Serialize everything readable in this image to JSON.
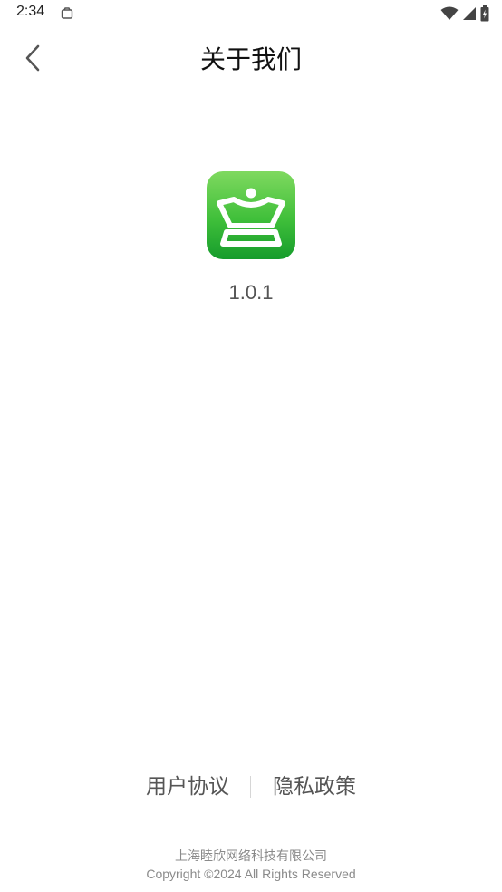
{
  "status_bar": {
    "time": "2:34",
    "notification_icon": "clipboard-icon",
    "icons": [
      "wifi-icon",
      "signal-icon",
      "battery-icon"
    ]
  },
  "header": {
    "title": "关于我们",
    "back_icon": "chevron-left-icon"
  },
  "app": {
    "icon": "crown-icon",
    "version": "1.0.1",
    "accent_color": "#3fbf3a"
  },
  "links": {
    "user_agreement": "用户协议",
    "privacy_policy": "隐私政策"
  },
  "footer": {
    "company": "上海睦欣网络科技有限公司",
    "copyright": "Copyright ©2024 All Rights Reserved"
  }
}
